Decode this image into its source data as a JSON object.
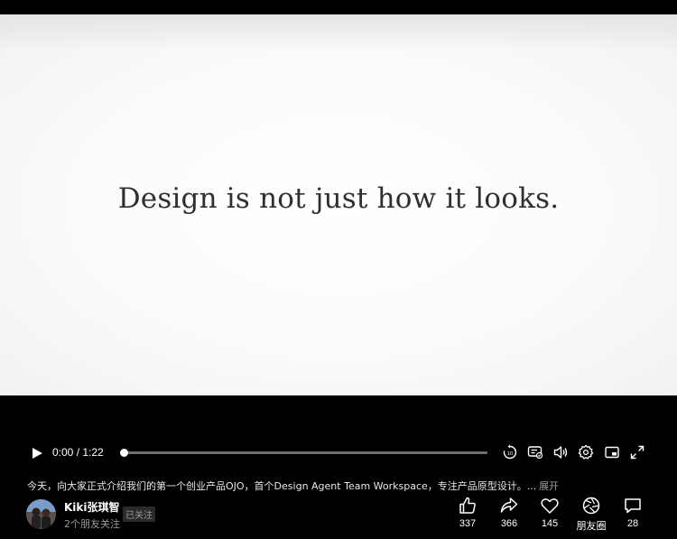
{
  "video": {
    "caption": "Design is not just how it looks."
  },
  "player": {
    "current_time": "0:00",
    "duration": "1:22",
    "time_display": "0:00 / 1:22",
    "progress": 0,
    "icons": [
      "play-icon",
      "rewind-10-icon",
      "danmaku-icon",
      "volume-icon",
      "settings-icon",
      "picture-in-picture-icon",
      "fullscreen-icon"
    ]
  },
  "post": {
    "description": "今天，向大家正式介绍我们的第一个创业产品OJO，首个Design Agent Team Workspace，专注产品原型设计。...",
    "expand_label": "展开"
  },
  "author": {
    "name": "Kiki张琪智",
    "follow_status": "已关注",
    "friends_following": "2个朋友关注"
  },
  "actions": {
    "like_count": "337",
    "share_count": "366",
    "favorite_count": "145",
    "moments_label": "朋友圈",
    "comment_count": "28"
  },
  "colors": {
    "background": "#000000",
    "video_bg": "#fbfbfb",
    "caption_text": "#2f2f2f",
    "muted_text": "#9a9a9a",
    "progress_track": "#6e6e6e"
  }
}
